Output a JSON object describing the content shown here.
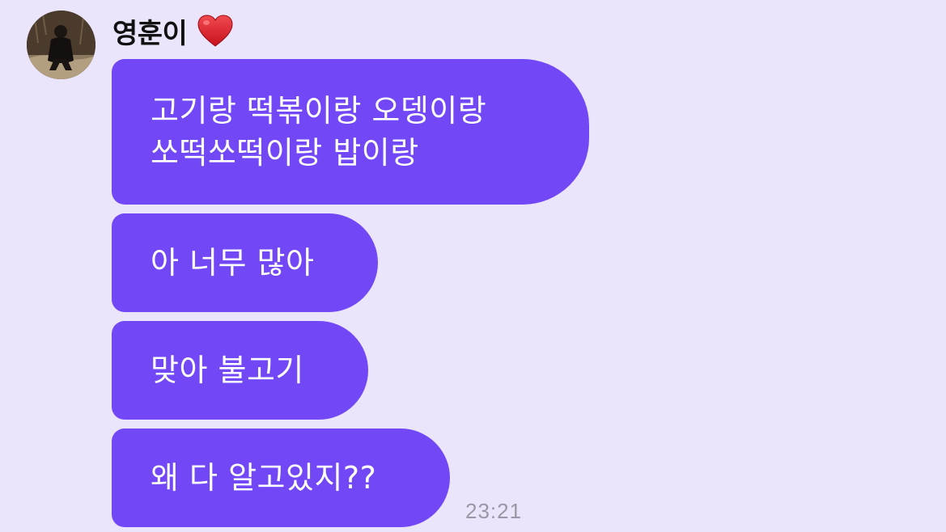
{
  "sender": {
    "name": "영훈이",
    "avatar_icon": "profile-photo-icon",
    "name_icon": "red-heart-icon"
  },
  "messages": [
    {
      "text": "고기랑 떡볶이랑 오뎅이랑\n쏘떡쏘떡이랑 밥이랑"
    },
    {
      "text": "아 너무 많아"
    },
    {
      "text": "맞아 불고기"
    },
    {
      "text": "왜 다 알고있지??"
    }
  ],
  "timestamp": "23:21",
  "colors": {
    "background": "#ebe5fb",
    "bubble": "#7247f6",
    "bubble_text": "#ffffff",
    "timestamp": "#9a97a5",
    "heart": "#e0202c"
  }
}
